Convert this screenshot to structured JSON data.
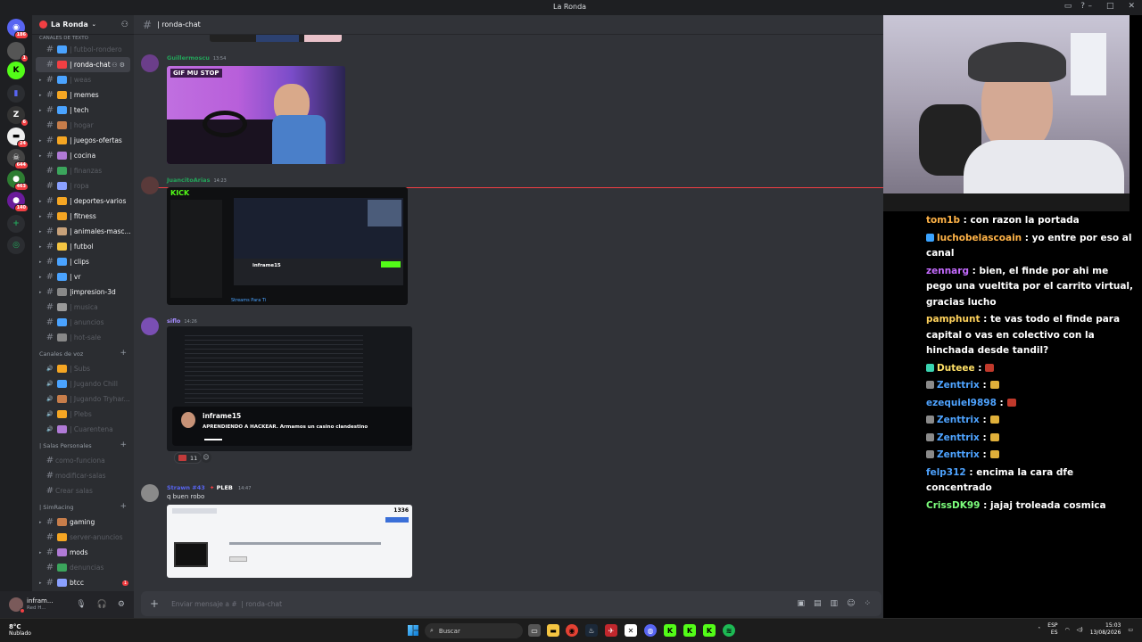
{
  "window": {
    "title": "La Ronda"
  },
  "servers": {
    "badges": [
      "186",
      "1",
      "6",
      "644",
      "463",
      "140",
      "41",
      "24"
    ]
  },
  "guild": {
    "name": "La Ronda"
  },
  "channels": {
    "category_top": "CANALES DE TEXTO",
    "text": [
      {
        "label": "| futbol-rondero",
        "state": "dim",
        "arrow": false
      },
      {
        "label": "| ronda-chat",
        "state": "active",
        "arrow": false
      },
      {
        "label": "| weas",
        "state": "dim",
        "arrow": true
      },
      {
        "label": "| memes",
        "state": "unread",
        "arrow": true
      },
      {
        "label": "| tech",
        "state": "unread",
        "arrow": true
      },
      {
        "label": "| hogar",
        "state": "dim",
        "arrow": false
      },
      {
        "label": "| juegos-ofertas",
        "state": "unread",
        "arrow": true
      },
      {
        "label": "| cocina",
        "state": "unread",
        "arrow": true
      },
      {
        "label": "| finanzas",
        "state": "dim",
        "arrow": false
      },
      {
        "label": "| ropa",
        "state": "dim",
        "arrow": false
      },
      {
        "label": "| deportes-varios",
        "state": "unread",
        "arrow": true
      },
      {
        "label": "| fitness",
        "state": "unread",
        "arrow": true
      },
      {
        "label": "| animales-masc...",
        "state": "unread",
        "arrow": true
      },
      {
        "label": "| futbol",
        "state": "unread",
        "arrow": true
      },
      {
        "label": "| clips",
        "state": "unread",
        "arrow": true
      },
      {
        "label": "| vr",
        "state": "unread",
        "arrow": true
      },
      {
        "label": "|impresion-3d",
        "state": "unread",
        "arrow": true
      },
      {
        "label": "| musica",
        "state": "dim",
        "arrow": false
      },
      {
        "label": "| anuncios",
        "state": "dim",
        "arrow": false
      },
      {
        "label": "| hot-sale",
        "state": "dim",
        "arrow": false
      }
    ],
    "voice_category": "Canales de voz",
    "voice": [
      "| Subs",
      "| Jugando Chill",
      "| Jugando Tryhar...",
      "| Plebs",
      "| Cuarentena"
    ],
    "personal_category": "| Salas Personales",
    "personal": [
      "como-funciona",
      "modificar-salas",
      "Crear salas"
    ],
    "sim_category": "| SimRacing",
    "sim": [
      "gaming",
      "server-anuncios",
      "mods",
      "denuncias",
      "btcc"
    ]
  },
  "user": {
    "name": "infram...",
    "status": "Red H..."
  },
  "chat": {
    "channel_title": "| ronda-chat",
    "composer_placeholder": "Enviar mensaje a #  | ronda-chat",
    "messages": [
      {
        "author": "Guillermoscu",
        "time": "13:54",
        "color": "#23a55a",
        "gif_label": "GIF MU STOP"
      },
      {
        "author": "JuancitoArias",
        "time": "14:23",
        "color": "#23a55a"
      },
      {
        "author": "siflo",
        "time": "14:26",
        "color": "#a58bff",
        "reaction_count": "11"
      },
      {
        "author": "Strawn #43",
        "role": "PLEB",
        "time": "14:47",
        "color": "#5865f2",
        "text": "q buen robo"
      }
    ],
    "embed_stream_name": "inframe15",
    "embed_stream_text": "APRENDIENDO A HACKEAR. Armamos un casino clandestino",
    "price": "1336"
  },
  "overlay_chat": [
    {
      "user": "tom1b",
      "color": "#ffb347",
      "text": ": con razon la portada"
    },
    {
      "user": "luchobelascoain",
      "color": "#ffb347",
      "text": ": yo entre por eso al canal"
    },
    {
      "user": "zennarg",
      "color": "#c56bff",
      "text": ": bien, el finde por ahi me pego una vueltita por el carrito virtual, gracias lucho"
    },
    {
      "user": "pamphunt",
      "color": "#ffd25c",
      "text": ": te vas todo el finde para capital o vas en colectivo con la hinchada desde tandil?"
    },
    {
      "user": "Duteee",
      "color": "#ffe066",
      "text": ":"
    },
    {
      "user": "Zenttrix",
      "color": "#4ea3ff",
      "text": ":"
    },
    {
      "user": "ezequiel9898",
      "color": "#4ea3ff",
      "text": ":"
    },
    {
      "user": "Zenttrix",
      "color": "#4ea3ff",
      "text": ":"
    },
    {
      "user": "Zenttrix",
      "color": "#4ea3ff",
      "text": ":"
    },
    {
      "user": "Zenttrix",
      "color": "#4ea3ff",
      "text": ":"
    },
    {
      "user": "felp312",
      "color": "#4ea3ff",
      "text": ": encima la cara dfe concentrado"
    },
    {
      "user": "CrissDK99",
      "color": "#7dff7d",
      "text": ": jajaj troleada cosmica"
    }
  ],
  "taskbar": {
    "weather_temp": "8°C",
    "weather_desc": "Nublado",
    "search": "Buscar",
    "lang": "ESP",
    "lang2": "ES",
    "time": "15:03",
    "date": "13/08/2026"
  }
}
